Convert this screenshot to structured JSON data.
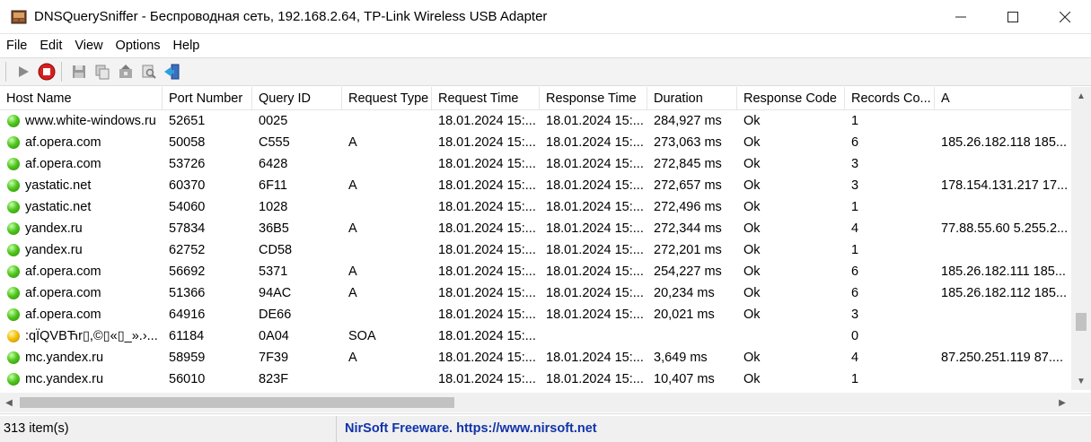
{
  "window": {
    "title": "DNSQuerySniffer  -  Беспроводная сеть, 192.168.2.64, TP-Link Wireless USB Adapter",
    "minimize": "—",
    "maximize": "☐",
    "close": "✕"
  },
  "menu": [
    "File",
    "Edit",
    "View",
    "Options",
    "Help"
  ],
  "toolbar": {
    "icons": [
      "play-icon",
      "stop-icon",
      "save-icon",
      "copy-icon",
      "html-report-icon",
      "find-icon",
      "exit-icon"
    ]
  },
  "table": {
    "columns": [
      "Host Name",
      "Port Number",
      "Query ID",
      "Request Type",
      "Request Time",
      "Response Time",
      "Duration",
      "Response Code",
      "Records Co...",
      "A"
    ],
    "rows": [
      {
        "status": "green",
        "cells": [
          "www.white-windows.ru",
          "52651",
          "0025",
          "",
          "18.01.2024 15:...",
          "18.01.2024 15:...",
          "284,927 ms",
          "Ok",
          "1",
          ""
        ]
      },
      {
        "status": "green",
        "cells": [
          "af.opera.com",
          "50058",
          "C555",
          "A",
          "18.01.2024 15:...",
          "18.01.2024 15:...",
          "273,063 ms",
          "Ok",
          "6",
          "185.26.182.118  185..."
        ]
      },
      {
        "status": "green",
        "cells": [
          "af.opera.com",
          "53726",
          "6428",
          "",
          "18.01.2024 15:...",
          "18.01.2024 15:...",
          "272,845 ms",
          "Ok",
          "3",
          ""
        ]
      },
      {
        "status": "green",
        "cells": [
          "yastatic.net",
          "60370",
          "6F11",
          "A",
          "18.01.2024 15:...",
          "18.01.2024 15:...",
          "272,657 ms",
          "Ok",
          "3",
          "178.154.131.217  17..."
        ]
      },
      {
        "status": "green",
        "cells": [
          "yastatic.net",
          "54060",
          "1028",
          "",
          "18.01.2024 15:...",
          "18.01.2024 15:...",
          "272,496 ms",
          "Ok",
          "1",
          ""
        ]
      },
      {
        "status": "green",
        "cells": [
          "yandex.ru",
          "57834",
          "36B5",
          "A",
          "18.01.2024 15:...",
          "18.01.2024 15:...",
          "272,344 ms",
          "Ok",
          "4",
          "77.88.55.60  5.255.2..."
        ]
      },
      {
        "status": "green",
        "cells": [
          "yandex.ru",
          "62752",
          "CD58",
          "",
          "18.01.2024 15:...",
          "18.01.2024 15:...",
          "272,201 ms",
          "Ok",
          "1",
          ""
        ]
      },
      {
        "status": "green",
        "cells": [
          "af.opera.com",
          "56692",
          "5371",
          "A",
          "18.01.2024 15:...",
          "18.01.2024 15:...",
          "254,227 ms",
          "Ok",
          "6",
          "185.26.182.111  185..."
        ]
      },
      {
        "status": "green",
        "cells": [
          "af.opera.com",
          "51366",
          "94AC",
          "A",
          "18.01.2024 15:...",
          "18.01.2024 15:...",
          "20,234 ms",
          "Ok",
          "6",
          "185.26.182.112  185..."
        ]
      },
      {
        "status": "green",
        "cells": [
          "af.opera.com",
          "64916",
          "DE66",
          "",
          "18.01.2024 15:...",
          "18.01.2024 15:...",
          "20,021 ms",
          "Ok",
          "3",
          ""
        ]
      },
      {
        "status": "yellow",
        "cells": [
          ":qÏQVBЋr▯,©▯«▯_».›...",
          "61184",
          "0A04",
          "SOA",
          "18.01.2024 15:...",
          "",
          "",
          "",
          "0",
          ""
        ]
      },
      {
        "status": "green",
        "cells": [
          "mc.yandex.ru",
          "58959",
          "7F39",
          "A",
          "18.01.2024 15:...",
          "18.01.2024 15:...",
          "3,649 ms",
          "Ok",
          "4",
          "87.250.251.119  87...."
        ]
      },
      {
        "status": "green",
        "cells": [
          "mc.yandex.ru",
          "56010",
          "823F",
          "",
          "18.01.2024 15:...",
          "18.01.2024 15:...",
          "10,407 ms",
          "Ok",
          "1",
          ""
        ]
      }
    ]
  },
  "statusbar": {
    "count": "313 item(s)",
    "link": "NirSoft Freeware. https://www.nirsoft.net"
  },
  "colors": {
    "link": "#1133aa",
    "toolbar_bg": "#f3f3f3",
    "statusbar_bg": "#f0f0f0"
  }
}
